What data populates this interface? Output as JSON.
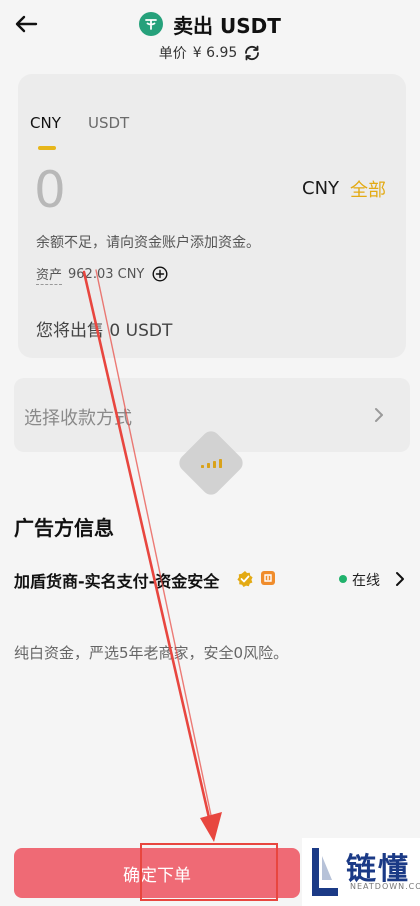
{
  "header": {
    "title": "卖出 USDT",
    "price_label": "单价",
    "price_value": "¥ 6.95"
  },
  "amount_card": {
    "tabs": [
      "CNY",
      "USDT"
    ],
    "active_tab": "CNY",
    "amount_value": "0",
    "currency": "CNY",
    "all_label": "全部",
    "warning": "余额不足，请向资金账户添加资金。",
    "assets_label": "资产",
    "assets_value": "962.03 CNY",
    "sell_summary": "您将出售 0 USDT"
  },
  "payment": {
    "placeholder": "选择收款方式"
  },
  "advertiser": {
    "section_title": "广告方信息",
    "merchant_name": "加盾货商-实名支付-资金安全",
    "status": "在线",
    "status_color": "#20b26c",
    "description": "纯白资金，严选5年老商家，安全0风险。"
  },
  "footer": {
    "confirm_label": "确定下单",
    "confirm_color": "#ef6a75"
  },
  "watermark": {
    "text": "链懂",
    "sub": "NEATDOWN.COM"
  },
  "annotation": {
    "arrow_color": "#e8463f"
  },
  "icons": {
    "back": "arrow-left-icon",
    "coin": "usdt-coin-icon",
    "refresh": "refresh-icon",
    "add": "add-circle-icon",
    "chevron": "chevron-right-icon",
    "verified": "verified-icon",
    "badge": "merchant-badge-icon",
    "loading": "loading-icon"
  }
}
